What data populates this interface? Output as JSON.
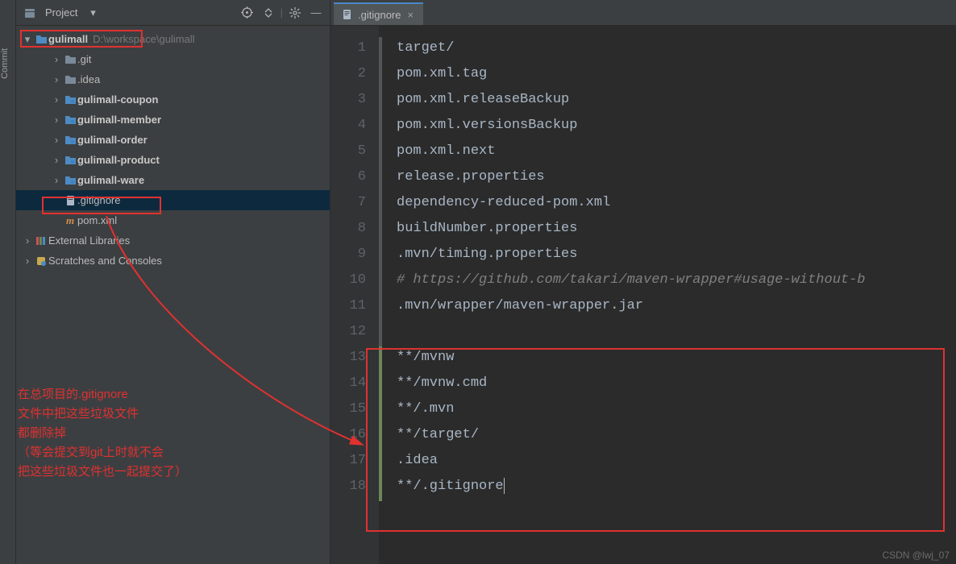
{
  "sidebar": {
    "header_title": "Project",
    "vbar_label": "Commit",
    "root": {
      "name": "gulimall",
      "path": "D:\\workspace\\gulimall"
    },
    "items": [
      {
        "name": ".git",
        "kind": "folder",
        "depth": 2
      },
      {
        "name": ".idea",
        "kind": "folder",
        "depth": 2
      },
      {
        "name": "gulimall-coupon",
        "kind": "module",
        "depth": 2
      },
      {
        "name": "gulimall-member",
        "kind": "module",
        "depth": 2
      },
      {
        "name": "gulimall-order",
        "kind": "module",
        "depth": 2
      },
      {
        "name": "gulimall-product",
        "kind": "module",
        "depth": 2
      },
      {
        "name": "gulimall-ware",
        "kind": "module",
        "depth": 2
      },
      {
        "name": ".gitignore",
        "kind": "file",
        "depth": 2,
        "selected": true
      },
      {
        "name": "pom.xml",
        "kind": "mfile",
        "depth": 2
      }
    ],
    "extra": [
      {
        "name": "External Libraries",
        "depth": 1,
        "icon": "lib"
      },
      {
        "name": "Scratches and Consoles",
        "depth": 1,
        "icon": "scratch"
      }
    ]
  },
  "editor": {
    "tab_name": ".gitignore",
    "lines": [
      {
        "n": 1,
        "t": "target/"
      },
      {
        "n": 2,
        "t": "pom.xml.tag"
      },
      {
        "n": 3,
        "t": "pom.xml.releaseBackup"
      },
      {
        "n": 4,
        "t": "pom.xml.versionsBackup"
      },
      {
        "n": 5,
        "t": "pom.xml.next"
      },
      {
        "n": 6,
        "t": "release.properties"
      },
      {
        "n": 7,
        "t": "dependency-reduced-pom.xml"
      },
      {
        "n": 8,
        "t": "buildNumber.properties"
      },
      {
        "n": 9,
        "t": ".mvn/timing.properties"
      },
      {
        "n": 10,
        "t": "# https://github.com/takari/maven-wrapper#usage-without-b",
        "cls": "comment"
      },
      {
        "n": 11,
        "t": ".mvn/wrapper/maven-wrapper.jar"
      },
      {
        "n": 12,
        "t": ""
      },
      {
        "n": 13,
        "t": "**/mvnw"
      },
      {
        "n": 14,
        "t": "**/mvnw.cmd"
      },
      {
        "n": 15,
        "t": "**/.mvn"
      },
      {
        "n": 16,
        "t": "**/target/"
      },
      {
        "n": 17,
        "t": ".idea"
      },
      {
        "n": 18,
        "t": "**/.gitignore",
        "caret": true
      }
    ]
  },
  "annotations": {
    "note1": "在总项目的.gitignore",
    "note2": "文件中把这些垃圾文件",
    "note3": "都删除掉",
    "note4": "（等会提交到git上时就不会",
    "note5": "把这些垃圾文件也一起提交了）"
  },
  "watermark": "CSDN @lwj_07"
}
